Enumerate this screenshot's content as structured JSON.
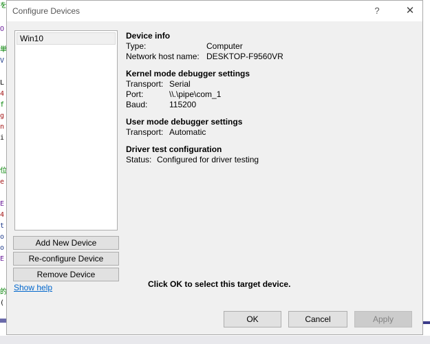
{
  "window": {
    "title": "Configure Devices",
    "help_glyph": "?",
    "close_glyph": "✕"
  },
  "background": {
    "code_chars": [
      "を",
      "O",
      "単",
      "V",
      "L",
      "4",
      "f",
      "g",
      "n",
      "i",
      "位",
      "e",
      "E",
      "4",
      "t",
      "o",
      "o",
      "E",
      "的",
      "("
    ]
  },
  "device_list": {
    "items": [
      "Win10"
    ]
  },
  "buttons": {
    "add_new": "Add New Device",
    "reconfigure": "Re-configure Device",
    "remove": "Remove Device",
    "ok": "OK",
    "cancel": "Cancel",
    "apply": "Apply"
  },
  "show_help": "Show help",
  "device_info": {
    "title": "Device info",
    "type_label": "Type:",
    "type_value": "Computer",
    "host_label": "Network host name:",
    "host_value": "DESKTOP-F9560VR"
  },
  "kernel": {
    "title": "Kernel mode debugger settings",
    "transport_label": "Transport:",
    "transport_value": "Serial",
    "port_label": "Port:",
    "port_value": "\\\\.\\pipe\\com_1",
    "baud_label": "Baud:",
    "baud_value": "115200"
  },
  "user_mode": {
    "title": "User mode debugger settings",
    "transport_label": "Transport:",
    "transport_value": "Automatic"
  },
  "driver_test": {
    "title": "Driver test configuration",
    "status_label": "Status:",
    "status_value": "Configured for driver testing"
  },
  "ok_message": "Click OK to select this target device.",
  "colors": {
    "link": "#0066cc",
    "dialog_bg": "#f0f0f0",
    "button_bg": "#e1e1e1",
    "disabled_text": "#838383"
  }
}
